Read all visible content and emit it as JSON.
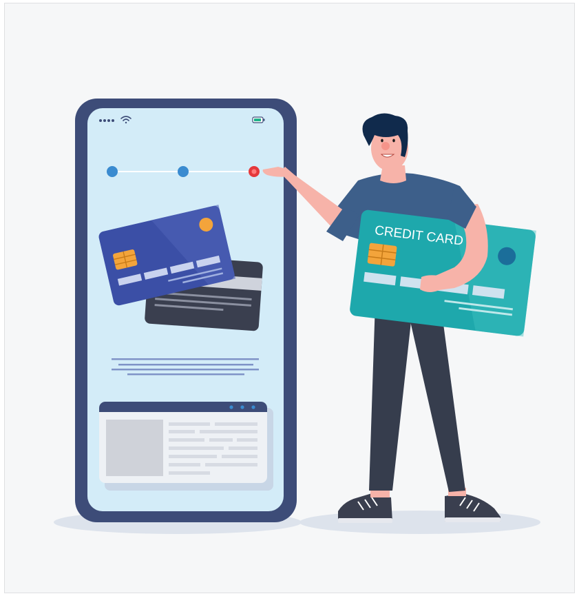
{
  "illustration": {
    "card_text": "CREDIT CARD",
    "colors": {
      "phone_frame": "#3d4c78",
      "phone_screen": "#d3ecf8",
      "step_done": "#3a8bd0",
      "step_active": "#e5383b",
      "card_blue": "#3b4fa6",
      "card_dark": "#3a3f4f",
      "card_teal": "#1ea8ac",
      "chip": "#f3a43b",
      "shirt": "#3d5f8a",
      "pants": "#363d4d",
      "hair": "#102a4c",
      "skin": "#f7b3a9"
    },
    "icons": [
      "signal-dots-icon",
      "wifi-icon",
      "battery-icon",
      "card-chip-icon"
    ]
  }
}
